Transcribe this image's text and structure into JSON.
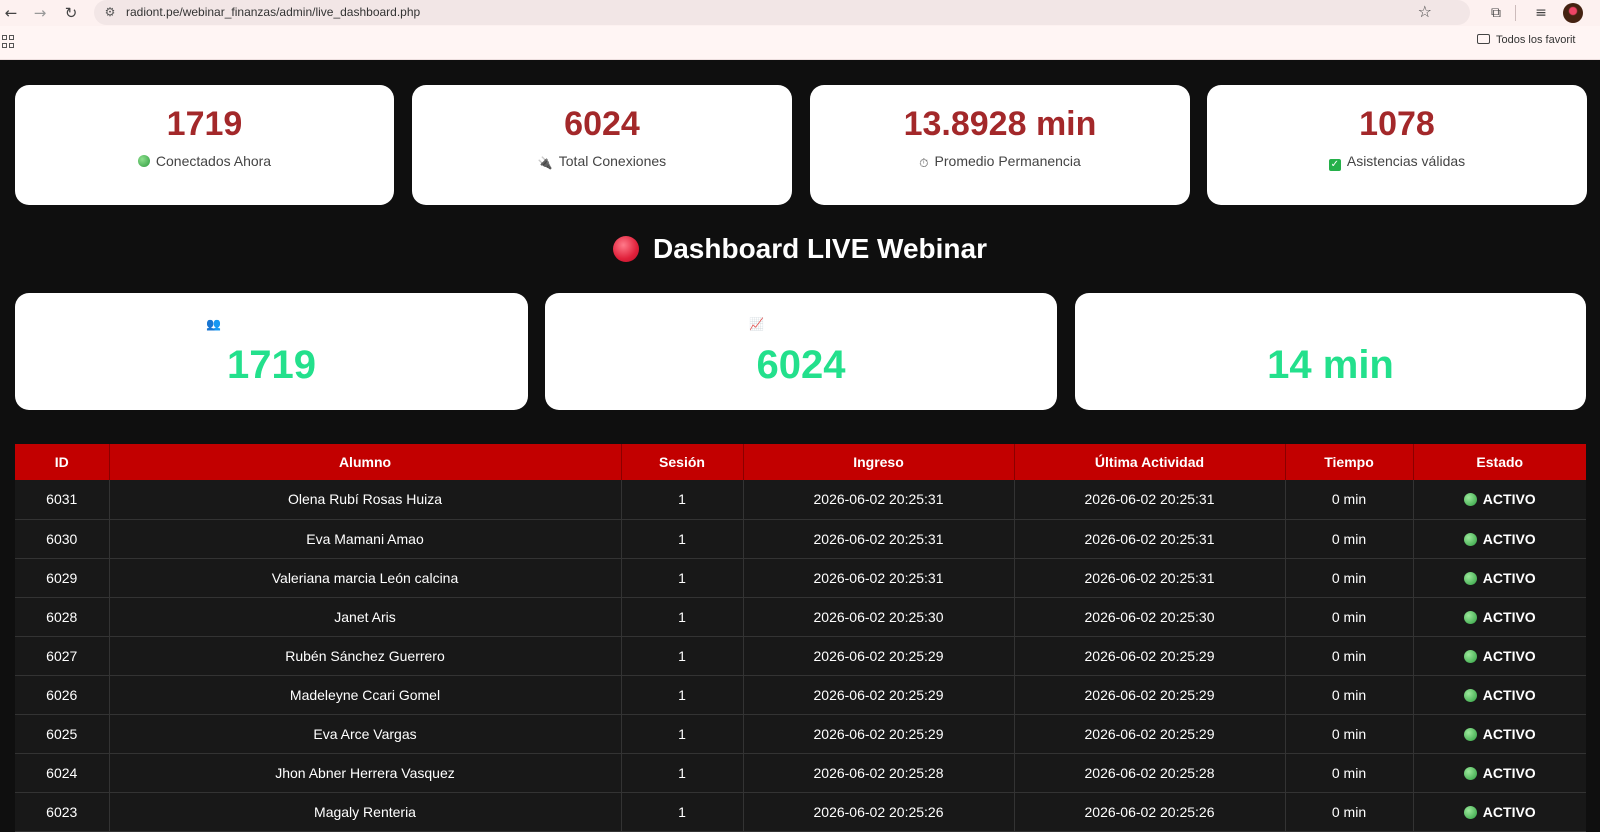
{
  "browser": {
    "url": "radiont.pe/webinar_finanzas/admin/live_dashboard.php",
    "bookmarks_folder": "Todos los favorit"
  },
  "stats": [
    {
      "value": "1719",
      "label": "Conectados Ahora",
      "icon": "green-circle-icon"
    },
    {
      "value": "6024",
      "label": "Total Conexiones",
      "icon": "plug-icon"
    },
    {
      "value": "13.8928 min",
      "label": "Promedio Permanencia",
      "icon": "stopwatch-icon"
    },
    {
      "value": "1078",
      "label": "Asistencias válidas",
      "icon": "check-mark-icon"
    }
  ],
  "title": "Dashboard LIVE Webinar",
  "live_cards": [
    {
      "value": "1719",
      "icon": "people-icon",
      "glyph": "👥"
    },
    {
      "value": "6024",
      "icon": "chart-increasing-icon",
      "glyph": "📈"
    },
    {
      "value": "14 min"
    }
  ],
  "table": {
    "headers": [
      "ID",
      "Alumno",
      "Sesión",
      "Ingreso",
      "Última Actividad",
      "Tiempo",
      "Estado"
    ],
    "rows": [
      [
        "6031",
        "Olena Rubí Rosas Huiza",
        "1",
        "2026-06-02 20:25:31",
        "2026-06-02 20:25:31",
        "0 min",
        "ACTIVO"
      ],
      [
        "6030",
        "Eva Mamani Amao",
        "1",
        "2026-06-02 20:25:31",
        "2026-06-02 20:25:31",
        "0 min",
        "ACTIVO"
      ],
      [
        "6029",
        "Valeriana marcia León calcina",
        "1",
        "2026-06-02 20:25:31",
        "2026-06-02 20:25:31",
        "0 min",
        "ACTIVO"
      ],
      [
        "6028",
        "Janet Aris",
        "1",
        "2026-06-02 20:25:30",
        "2026-06-02 20:25:30",
        "0 min",
        "ACTIVO"
      ],
      [
        "6027",
        "Rubén Sánchez Guerrero",
        "1",
        "2026-06-02 20:25:29",
        "2026-06-02 20:25:29",
        "0 min",
        "ACTIVO"
      ],
      [
        "6026",
        "Madeleyne Ccari Gomel",
        "1",
        "2026-06-02 20:25:29",
        "2026-06-02 20:25:29",
        "0 min",
        "ACTIVO"
      ],
      [
        "6025",
        "Eva Arce Vargas",
        "1",
        "2026-06-02 20:25:29",
        "2026-06-02 20:25:29",
        "0 min",
        "ACTIVO"
      ],
      [
        "6024",
        "Jhon Abner Herrera Vasquez",
        "1",
        "2026-06-02 20:25:28",
        "2026-06-02 20:25:28",
        "0 min",
        "ACTIVO"
      ],
      [
        "6023",
        "Magaly Renteria",
        "1",
        "2026-06-02 20:25:26",
        "2026-06-02 20:25:26",
        "0 min",
        "ACTIVO"
      ]
    ]
  }
}
